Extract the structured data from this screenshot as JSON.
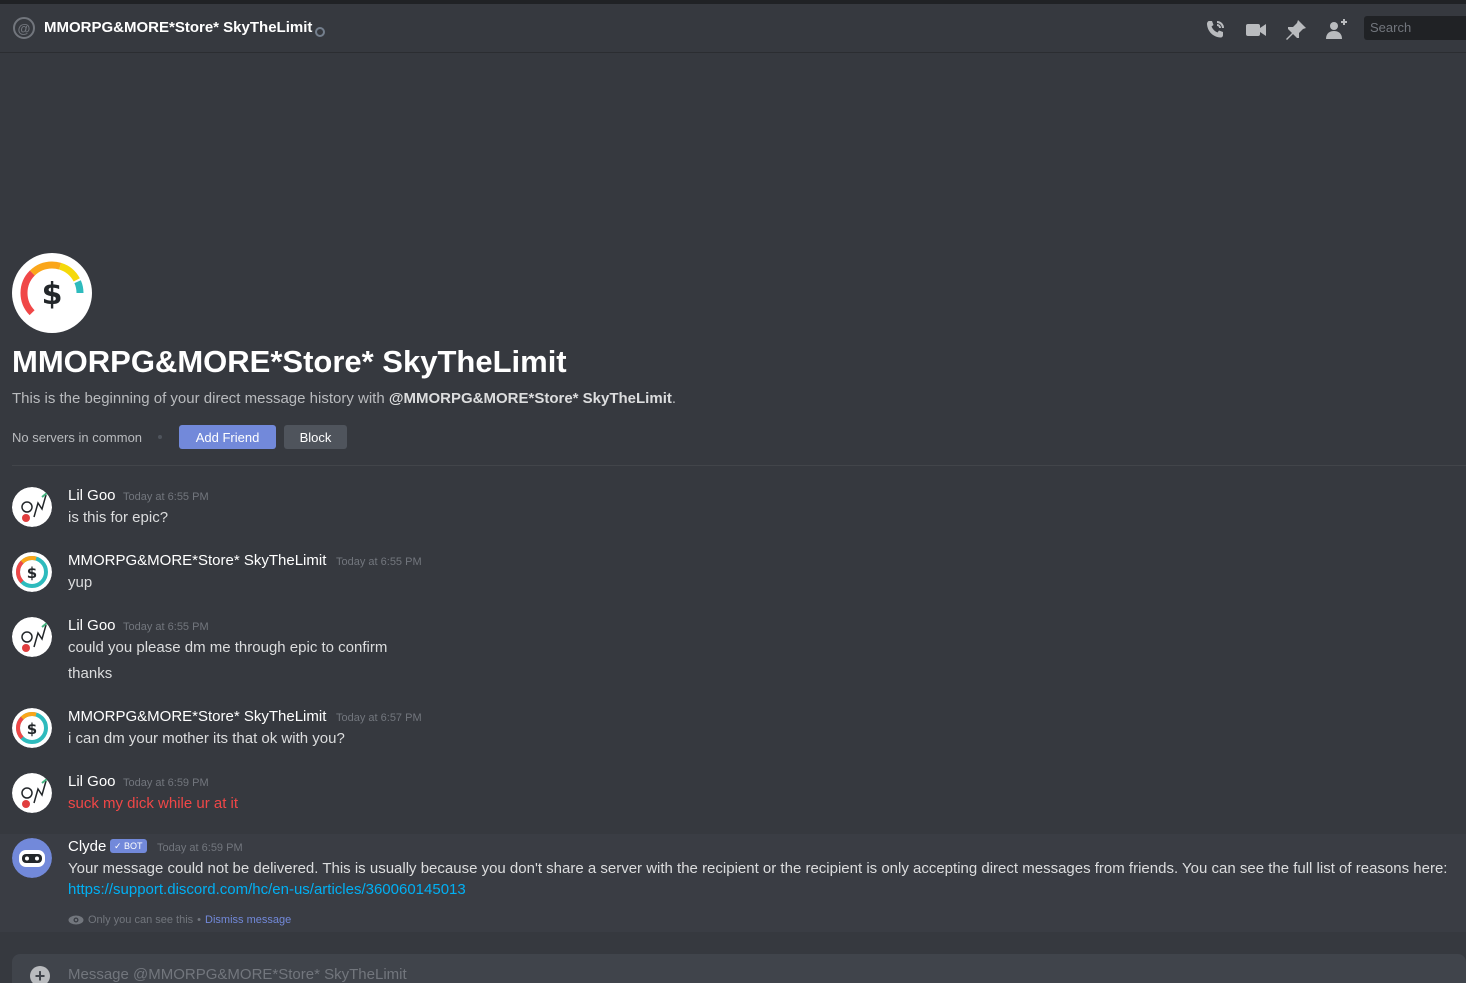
{
  "header": {
    "title": "MMORPG&MORE*Store* SkyTheLimit",
    "search_placeholder": "Search",
    "icons": [
      "at-icon",
      "call-icon",
      "video-icon",
      "pin-icon",
      "add-friend-icon"
    ]
  },
  "welcome": {
    "title": "MMORPG&MORE*Store* SkyTheLimit",
    "subtitle_prefix": "This is the beginning of your direct message history with ",
    "subtitle_user": "@MMORPG&MORE*Store* SkyTheLimit",
    "subtitle_suffix": ".",
    "servers_text": "No servers in common",
    "add_friend_label": "Add Friend",
    "block_label": "Block"
  },
  "messages": [
    {
      "author": "Lil Goo",
      "time": "Today at 6:55 PM",
      "lines": [
        "is this for epic?"
      ]
    },
    {
      "author": "MMORPG&MORE*Store* SkyTheLimit",
      "time": "Today at 6:55 PM",
      "lines": [
        "yup"
      ]
    },
    {
      "author": "Lil Goo",
      "time": "Today at 6:55 PM",
      "lines": [
        "could you please dm me through epic to confirm",
        "thanks"
      ]
    },
    {
      "author": "MMORPG&MORE*Store* SkyTheLimit",
      "time": "Today at 6:57 PM",
      "lines": [
        "i can dm your mother its that ok with you?"
      ]
    },
    {
      "author": "Lil Goo",
      "time": "Today at 6:59 PM",
      "lines": [
        "suck my dick while ur at it"
      ],
      "failed": true
    },
    {
      "author": "Clyde",
      "bot_tag": "BOT",
      "time": "Today at 6:59 PM",
      "lines": [
        "Your message could not be delivered. This is usually because you don't share a server with the recipient or the recipient is only accepting direct messages from friends. You can see the full list of reasons here:"
      ],
      "link": "https://support.discord.com/hc/en-us/articles/360060145013",
      "ephemeral_note": "Only you can see this",
      "ephemeral_sep": "•",
      "dismiss_label": "Dismiss message"
    }
  ],
  "composer": {
    "placeholder": "Message @MMORPG&MORE*Store* SkyTheLimit"
  },
  "colors": {
    "background": "#36393f",
    "accent": "#7289da",
    "link": "#00b0f4",
    "failed_text": "#f04747"
  }
}
